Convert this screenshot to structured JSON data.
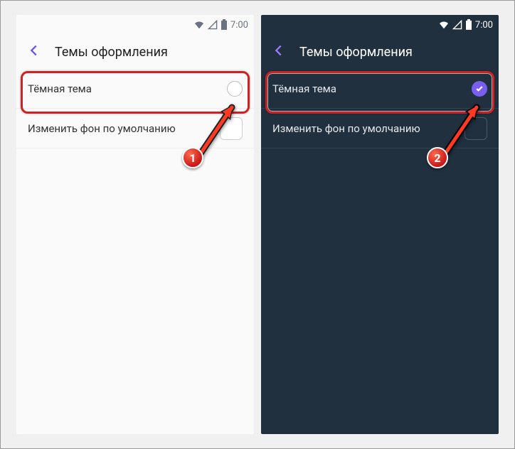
{
  "status": {
    "time": "7:00"
  },
  "header": {
    "title": "Темы оформления"
  },
  "rows": {
    "dark_theme": "Тёмная тема",
    "change_bg": "Изменить фон по умолчанию"
  },
  "badges": {
    "left": "1",
    "right": "2"
  }
}
